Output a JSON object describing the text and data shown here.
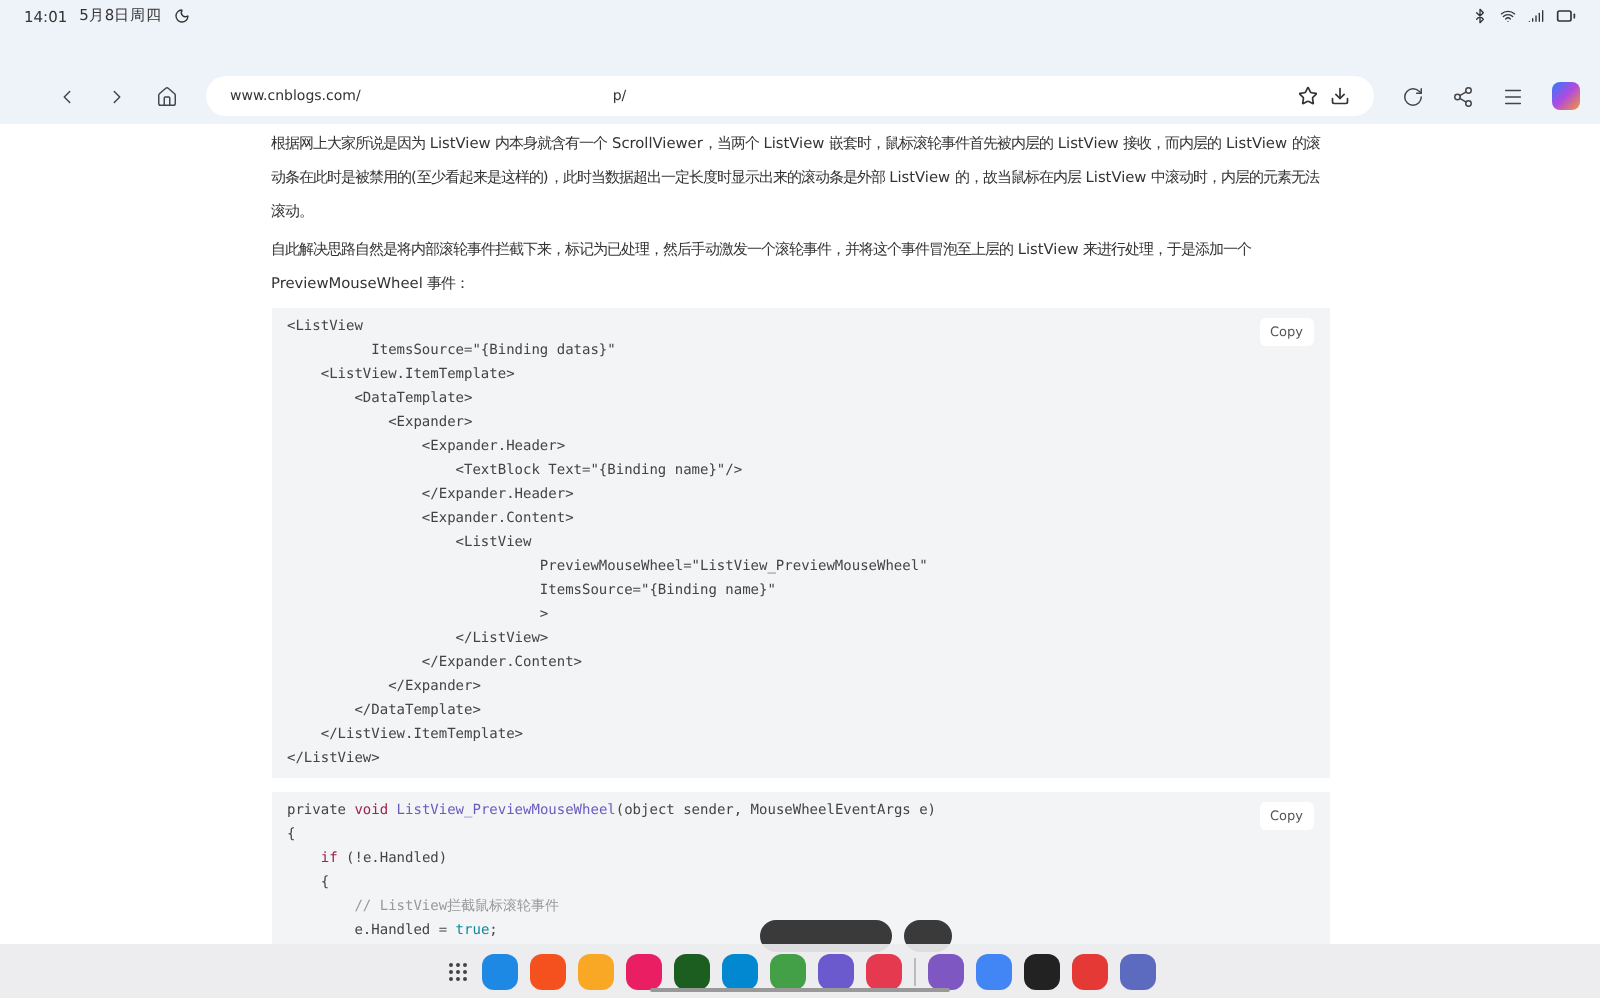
{
  "status_bar": {
    "time": "14:01",
    "date": "5月8日周四"
  },
  "toolbar": {
    "url": "www.cnblogs.com/",
    "url_tail": "p/"
  },
  "article": {
    "paragraphs": [
      "根据网上大家所说是因为 ListView 内本身就含有一个 ScrollViewer，当两个 ListView 嵌套时，鼠标滚轮事件首先被内层的 ListView 接收，而内层的 ListView 的滚动条在此时是被禁用的(至少看起来是这样的)，此时当数据超出一定长度时显示出来的滚动条是外部 ListView 的，故当鼠标在内层 ListView 中滚动时，内层的元素无法滚动。",
      "自此解决思路自然是将内部滚轮事件拦截下来，标记为已处理，然后手动激发一个滚轮事件，并将这个事件冒泡至上层的 ListView 来进行处理，于是添加一个 PreviewMouseWheel 事件："
    ],
    "code_blocks": [
      {
        "copy": "Copy",
        "lines": [
          [
            {
              "text": "<ListView",
              "kind": "plain"
            }
          ],
          [
            {
              "text": "          ItemsSource=\"{Binding datas}\"",
              "kind": "plain"
            }
          ],
          [
            {
              "text": "    <ListView.ItemTemplate>",
              "kind": "plain"
            }
          ],
          [
            {
              "text": "        <DataTemplate>",
              "kind": "plain"
            }
          ],
          [
            {
              "text": "            <Expander>",
              "kind": "plain"
            }
          ],
          [
            {
              "text": "                <Expander.Header>",
              "kind": "plain"
            }
          ],
          [
            {
              "text": "                    <TextBlock Text=\"{Binding name}\"/>",
              "kind": "plain"
            }
          ],
          [
            {
              "text": "                </Expander.Header>",
              "kind": "plain"
            }
          ],
          [
            {
              "text": "                <Expander.Content>",
              "kind": "plain"
            }
          ],
          [
            {
              "text": "                    <ListView",
              "kind": "plain"
            }
          ],
          [
            {
              "text": "                              PreviewMouseWheel=\"ListView_PreviewMouseWheel\"",
              "kind": "plain"
            }
          ],
          [
            {
              "text": "                              ItemsSource=\"{Binding name}\"",
              "kind": "plain"
            }
          ],
          [
            {
              "text": "                              >",
              "kind": "plain"
            }
          ],
          [
            {
              "text": "                    </ListView>",
              "kind": "plain"
            }
          ],
          [
            {
              "text": "                </Expander.Content>",
              "kind": "plain"
            }
          ],
          [
            {
              "text": "            </Expander>",
              "kind": "plain"
            }
          ],
          [
            {
              "text": "        </DataTemplate>",
              "kind": "plain"
            }
          ],
          [
            {
              "text": "    </ListView.ItemTemplate>",
              "kind": "plain"
            }
          ],
          [
            {
              "text": "</ListView>",
              "kind": "plain"
            }
          ]
        ]
      },
      {
        "copy": "Copy",
        "lines": [
          [
            {
              "text": "private ",
              "kind": "plain"
            },
            {
              "text": "void ",
              "kind": "keyword"
            },
            {
              "text": "ListView_PreviewMouseWheel",
              "kind": "method"
            },
            {
              "text": "(object sender, MouseWheelEventArgs e)",
              "kind": "plain"
            }
          ],
          [
            {
              "text": "{",
              "kind": "plain"
            }
          ],
          [
            {
              "text": "    if ",
              "kind": "keyword"
            },
            {
              "text": "(!e.Handled)",
              "kind": "plain"
            }
          ],
          [
            {
              "text": "    {",
              "kind": "plain"
            }
          ],
          [
            {
              "text": "        // ListView拦截鼠标滚轮事件",
              "kind": "comment"
            }
          ],
          [
            {
              "text": "        e.Handled = ",
              "kind": "plain"
            },
            {
              "text": "true",
              "kind": "literal"
            },
            {
              "text": ";",
              "kind": "plain"
            }
          ]
        ]
      }
    ]
  },
  "dock": {
    "apps": [
      {
        "color": "#1e88e5"
      },
      {
        "color": "#f4511e"
      },
      {
        "color": "#f9a825"
      },
      {
        "color": "#e91e63"
      },
      {
        "color": "#1b5e20"
      },
      {
        "color": "#0288d1"
      },
      {
        "color": "#43a047"
      },
      {
        "color": "#6a5acd"
      },
      {
        "color": "#e53950"
      },
      {
        "color": "#7e57c2"
      },
      {
        "color": "#4285f4"
      },
      {
        "color": "#222222"
      },
      {
        "color": "#e53935"
      },
      {
        "color": "#5c6bc0"
      }
    ]
  }
}
